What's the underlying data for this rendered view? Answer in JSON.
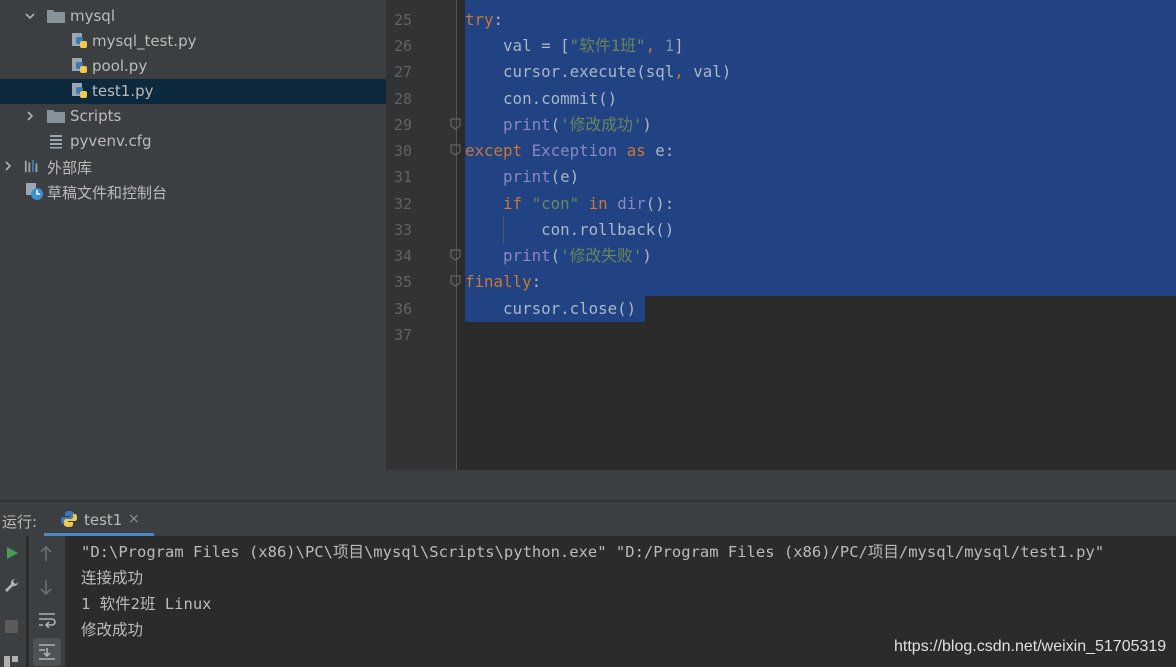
{
  "project_tree": [
    {
      "label": "mysql",
      "type": "folder",
      "expanded": true
    },
    {
      "label": "mysql_test.py",
      "type": "python-file"
    },
    {
      "label": "pool.py",
      "type": "python-file"
    },
    {
      "label": "test1.py",
      "type": "python-file",
      "selected": true
    },
    {
      "label": "Scripts",
      "type": "folder",
      "expanded": false
    },
    {
      "label": "pyvenv.cfg",
      "type": "config-file"
    },
    {
      "label": "外部库",
      "type": "library",
      "expanded": false
    },
    {
      "label": "草稿文件和控制台",
      "type": "scratches"
    }
  ],
  "editor": {
    "line_numbers": [
      "25",
      "26",
      "27",
      "28",
      "29",
      "30",
      "31",
      "32",
      "33",
      "34",
      "35",
      "36",
      "37"
    ],
    "lines": [
      "try:",
      "    val = [\"软件1班\", 1]",
      "    cursor.execute(sql, val)",
      "    con.commit()",
      "    print('修改成功')",
      "except Exception as e:",
      "    print(e)",
      "    if \"con\" in dir():",
      "        con.rollback()",
      "    print('修改失败')",
      "finally:",
      "    cursor.close()",
      ""
    ]
  },
  "run_panel": {
    "label": "运行:",
    "tab_label": "test1",
    "tab_close": "×",
    "output": [
      "\"D:\\Program Files (x86)\\PC\\项目\\mysql\\Scripts\\python.exe\" \"D:/Program Files (x86)/PC/项目/mysql/mysql/test1.py\"",
      "连接成功",
      "1 软件2班 Linux",
      "修改成功"
    ]
  },
  "watermark": "https://blog.csdn.net/weixin_51705319",
  "colors": {
    "selection": "#214283",
    "keyword": "#cc7832",
    "string": "#6a8759",
    "number": "#6897bb",
    "builtin": "#8888c6",
    "run_icon": "#499c54"
  }
}
